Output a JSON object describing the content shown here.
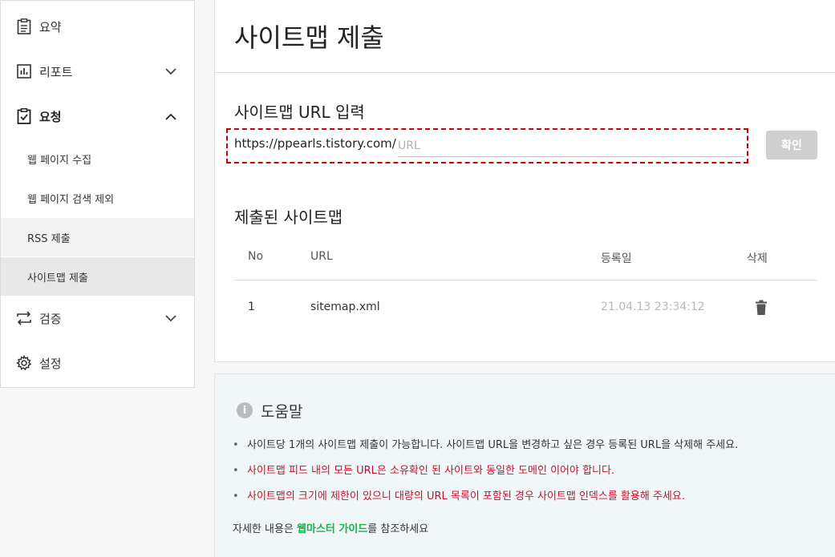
{
  "sidebar": {
    "items": [
      {
        "label": "요약",
        "icon": "clipboard-icon"
      },
      {
        "label": "리포트",
        "icon": "chart-icon"
      },
      {
        "label": "요청",
        "icon": "clipboard-check-icon"
      },
      {
        "label": "검증",
        "icon": "swap-icon"
      },
      {
        "label": "설정",
        "icon": "gear-icon"
      }
    ],
    "sub_items": [
      {
        "label": "웹 페이지 수집"
      },
      {
        "label": "웹 페이지 검색 제외"
      },
      {
        "label": "RSS 제출"
      },
      {
        "label": "사이트맵 제출"
      }
    ]
  },
  "main": {
    "title": "사이트맵 제출",
    "input_section_title": "사이트맵 URL 입력",
    "url_prefix": "https://ppearls.tistory.com/",
    "url_placeholder": "URL",
    "url_value": "",
    "confirm_label": "확인",
    "submitted_title": "제출된 사이트맵",
    "table": {
      "headers": [
        "No",
        "URL",
        "등록일",
        "삭제"
      ],
      "rows": [
        {
          "no": "1",
          "url": "sitemap.xml",
          "date": "21.04.13 23:34:12"
        }
      ]
    }
  },
  "help": {
    "title": "도움말",
    "items": [
      "사이트당 1개의 사이트맵 제출이 가능합니다. 사이트맵 URL을 변경하고 싶은 경우 등록된 URL을 삭제해 주세요.",
      "사이트맵 피드 내의 모든 URL은 소유확인 된 사이트와 동일한 도메인 이어야 합니다.",
      "사이트맵의 크기에 제한이 있으니 대량의 URL 목록이 포함된 경우 사이트맵 인덱스를 활용해 주세요."
    ],
    "footer_prefix": "자세한 내용은 ",
    "footer_link": "웹마스터 가이드",
    "footer_suffix": "를 참조하세요"
  },
  "colors": {
    "highlight_border": "#cc0000",
    "warning_text": "#c8102e",
    "link": "#1ab24a",
    "button_disabled": "#cfcfcf"
  }
}
